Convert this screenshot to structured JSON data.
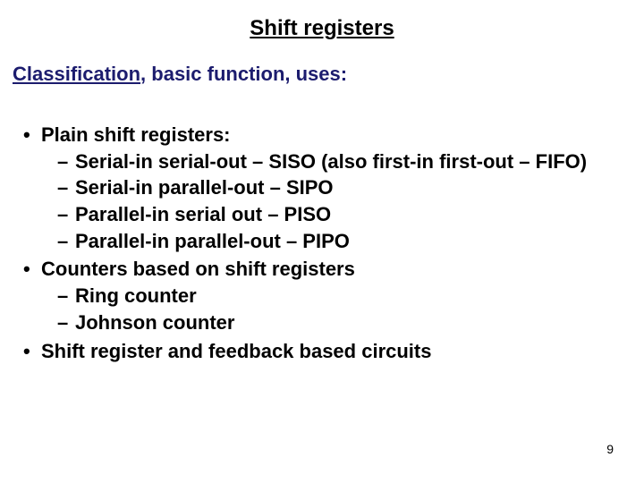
{
  "title": "Shift registers",
  "subtitle_underlined": "Classification",
  "subtitle_rest": ", basic function, uses:",
  "bullets": [
    {
      "label": "Plain shift registers:",
      "subs": [
        "Serial-in serial-out – SISO (also first-in first-out – FIFO)",
        "Serial-in parallel-out – SIPO",
        "Parallel-in serial out – PISO",
        "Parallel-in parallel-out – PIPO"
      ]
    },
    {
      "label": "Counters based on shift registers",
      "subs": [
        "Ring counter",
        "Johnson counter"
      ]
    },
    {
      "label": "Shift register and feedback based circuits",
      "subs": []
    }
  ],
  "page_number": "9"
}
